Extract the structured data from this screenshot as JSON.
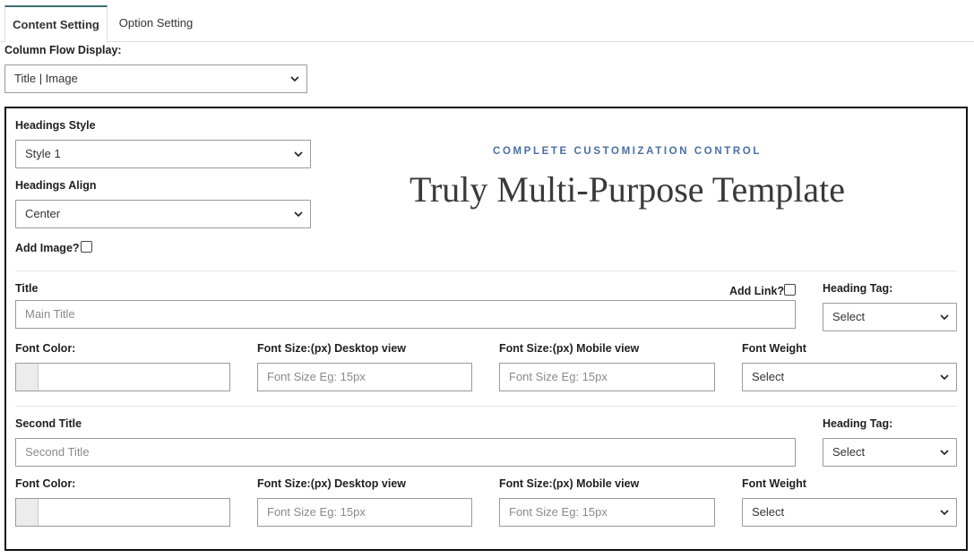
{
  "tabs": {
    "content_setting": "Content Setting",
    "option_setting": "Option Setting"
  },
  "column_flow": {
    "label": "Column Flow Display:",
    "value": "Title | Image"
  },
  "headings": {
    "style_label": "Headings Style",
    "style_value": "Style 1",
    "align_label": "Headings Align",
    "align_value": "Center",
    "add_image_label": "Add Image?"
  },
  "preview": {
    "eyebrow": "COMPLETE CUSTOMIZATION CONTROL",
    "headline": "Truly Multi-Purpose Template"
  },
  "title_section": {
    "label": "Title",
    "placeholder": "Main Title",
    "add_link_label": "Add Link?",
    "heading_tag_label": "Heading Tag:",
    "heading_tag_value": "Select",
    "font_color_label": "Font Color:",
    "font_size_desktop_label": "Font Size:(px) Desktop view",
    "font_size_desktop_placeholder": "Font Size Eg: 15px",
    "font_size_mobile_label": "Font Size:(px) Mobile view",
    "font_size_mobile_placeholder": "Font Size Eg: 15px",
    "font_weight_label": "Font Weight",
    "font_weight_value": "Select"
  },
  "second_title_section": {
    "label": "Second Title",
    "placeholder": "Second Title",
    "heading_tag_label": "Heading Tag:",
    "heading_tag_value": "Select",
    "font_color_label": "Font Color:",
    "font_size_desktop_label": "Font Size:(px) Desktop view",
    "font_size_desktop_placeholder": "Font Size Eg: 15px",
    "font_size_mobile_label": "Font Size:(px) Mobile view",
    "font_size_mobile_placeholder": "Font Size Eg: 15px",
    "font_weight_label": "Font Weight",
    "font_weight_value": "Select"
  },
  "colors": {
    "tab_accent": "#3a6f73",
    "eyebrow": "#4a6fa5",
    "headline": "#3a3a3a"
  }
}
